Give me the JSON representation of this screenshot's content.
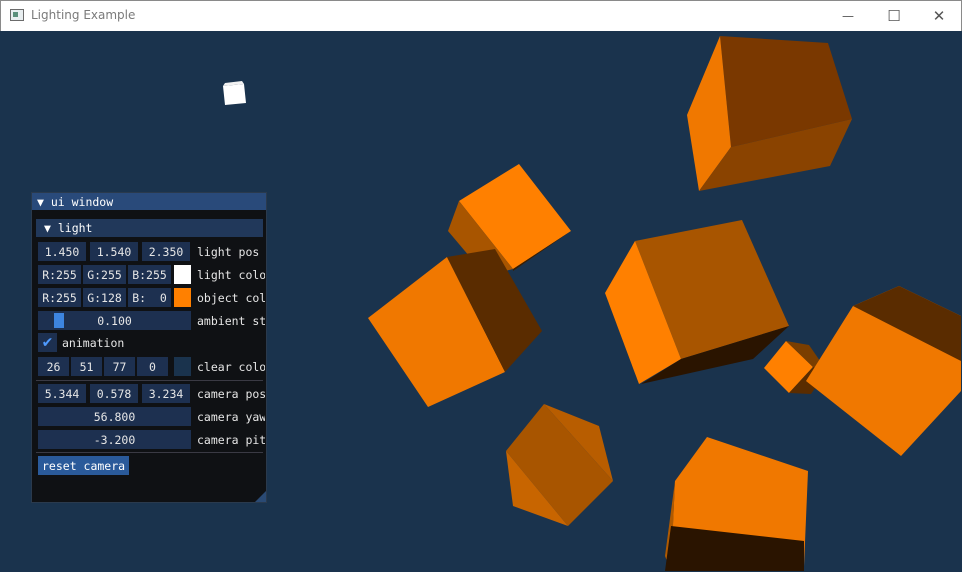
{
  "window": {
    "title": "Lighting Example",
    "minimize": "—",
    "maximize": "☐",
    "close": "✕"
  },
  "panel": {
    "title": "▼ ui window",
    "section": "▼  light",
    "light_pos": {
      "x": "1.450",
      "y": "1.540",
      "z": "2.350",
      "label": "light pos"
    },
    "light_color": {
      "r": "R:255",
      "g": "G:255",
      "b": "B:255",
      "label": "light colo",
      "swatch": "#ffffff"
    },
    "object_color": {
      "r": "R:255",
      "g": "G:128",
      "b": "B:  0",
      "label": "object col",
      "swatch": "#ff8000"
    },
    "ambient": {
      "value": "0.100",
      "label": "ambient st",
      "fraction": 0.1
    },
    "animation": {
      "label": "animation",
      "checked": true
    },
    "clear_color": {
      "r": "26",
      "g": "51",
      "b": "77",
      "a": "0",
      "label": "clear colo",
      "swatch": "#1a334d"
    },
    "camera_pos": {
      "x": "5.344",
      "y": "0.578",
      "z": "3.234",
      "label": "camera pos"
    },
    "camera_yaw": {
      "value": "56.800",
      "label": "camera yaw"
    },
    "camera_pitch": {
      "value": "-3.200",
      "label": "camera pit"
    },
    "reset_label": "reset camera"
  },
  "scene": {
    "background": "#1a334d",
    "cube_color": "#ff8000",
    "light_cube_color": "#ffffff"
  }
}
